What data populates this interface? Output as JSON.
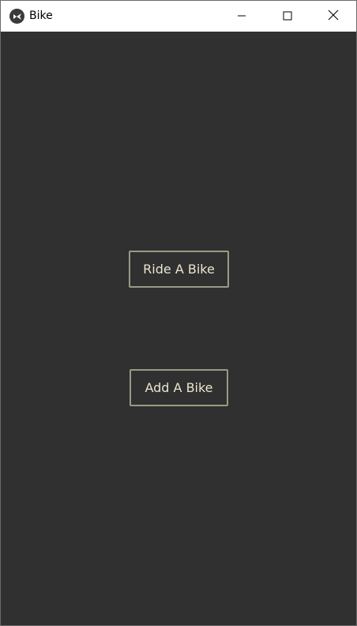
{
  "window": {
    "title": "Bike",
    "app_icon": "kivy-logo-icon"
  },
  "caption_buttons": {
    "minimize": "minimize-icon",
    "maximize": "maximize-icon",
    "close": "close-icon"
  },
  "main": {
    "ride_button_label": "Ride A Bike",
    "add_button_label": "Add A Bike"
  },
  "colors": {
    "content_background": "#303030",
    "button_border": "#9a9a86",
    "button_text": "#e9e5cf"
  }
}
